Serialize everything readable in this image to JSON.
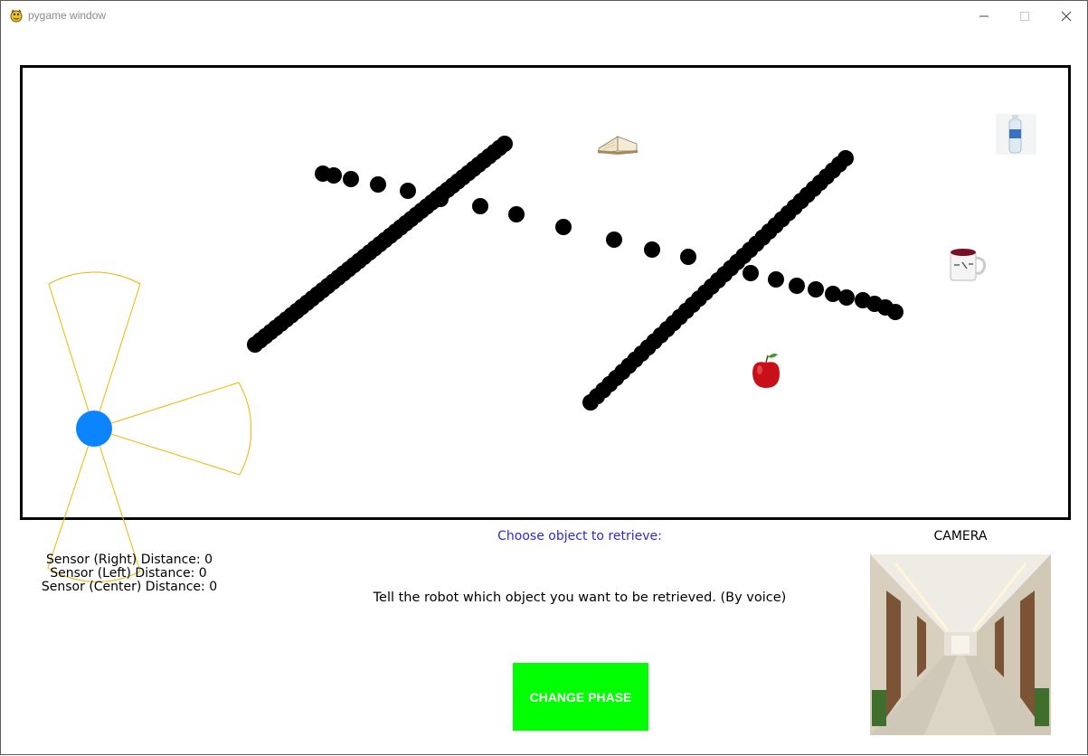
{
  "window": {
    "title": "pygame window"
  },
  "sensors": {
    "right": "Sensor (Right) Distance: 0",
    "left": "Sensor (Left) Distance: 0",
    "center": "Sensor (Center) Distance: 0"
  },
  "prompt": {
    "title": "Choose object to retrieve:",
    "instruction": "Tell the robot which object you want to be retrieved. (By voice)"
  },
  "phase_button": {
    "label": "CHANGE PHASE",
    "color": "#00ff00"
  },
  "camera": {
    "label": "CAMERA"
  },
  "robot": {
    "color": "#0a84ff"
  },
  "sensor_cone_color": "#f0b400",
  "arena_objects": [
    "book-icon",
    "water-bottle-icon",
    "mug-icon",
    "apple-icon"
  ]
}
